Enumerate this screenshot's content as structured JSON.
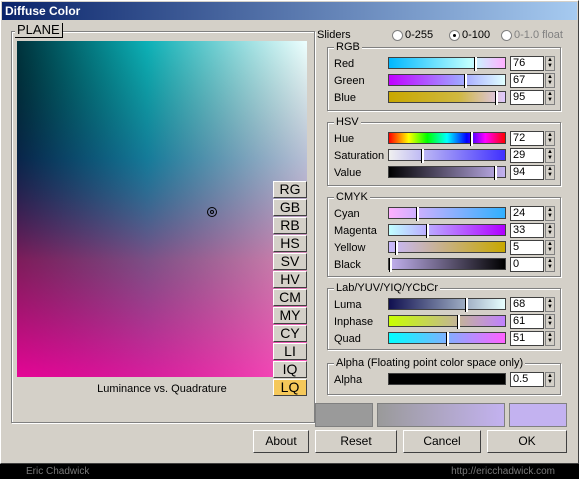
{
  "window": {
    "title": "Diffuse Color"
  },
  "plane": {
    "label": "PLANE",
    "caption": "Luminance vs. Quadrature"
  },
  "modes": [
    "RG",
    "GB",
    "RB",
    "HS",
    "SV",
    "HV",
    "CM",
    "MY",
    "CY",
    "LI",
    "IQ",
    "LQ"
  ],
  "active_mode": "LQ",
  "sliders": {
    "label": "Sliders",
    "options": [
      "0-255",
      "0-100",
      "0-1.0 float"
    ],
    "selected": "0-100"
  },
  "groups": {
    "rgb": {
      "title": "RGB",
      "rows": [
        {
          "label": "Red",
          "value": "76"
        },
        {
          "label": "Green",
          "value": "67"
        },
        {
          "label": "Blue",
          "value": "95"
        }
      ]
    },
    "hsv": {
      "title": "HSV",
      "rows": [
        {
          "label": "Hue",
          "value": "72"
        },
        {
          "label": "Saturation",
          "value": "29"
        },
        {
          "label": "Value",
          "value": "94"
        }
      ]
    },
    "cmyk": {
      "title": "CMYK",
      "rows": [
        {
          "label": "Cyan",
          "value": "24"
        },
        {
          "label": "Magenta",
          "value": "33"
        },
        {
          "label": "Yellow",
          "value": "5"
        },
        {
          "label": "Black",
          "value": "0"
        }
      ]
    },
    "lab": {
      "title": "Lab/YUV/YIQ/YCbCr",
      "rows": [
        {
          "label": "Luma",
          "value": "68"
        },
        {
          "label": "Inphase",
          "value": "61"
        },
        {
          "label": "Quad",
          "value": "51"
        }
      ]
    },
    "alpha": {
      "title": "Alpha (Floating point color space only)",
      "rows": [
        {
          "label": "Alpha",
          "value": "0.5"
        }
      ]
    }
  },
  "buttons": {
    "about": "About",
    "reset": "Reset",
    "cancel": "Cancel",
    "ok": "OK"
  },
  "footer": {
    "left": "Eric Chadwick",
    "right": "http://ericchadwick.com"
  },
  "colors": {
    "current": "#c3b2f0",
    "previous": "#9a9a9a"
  }
}
